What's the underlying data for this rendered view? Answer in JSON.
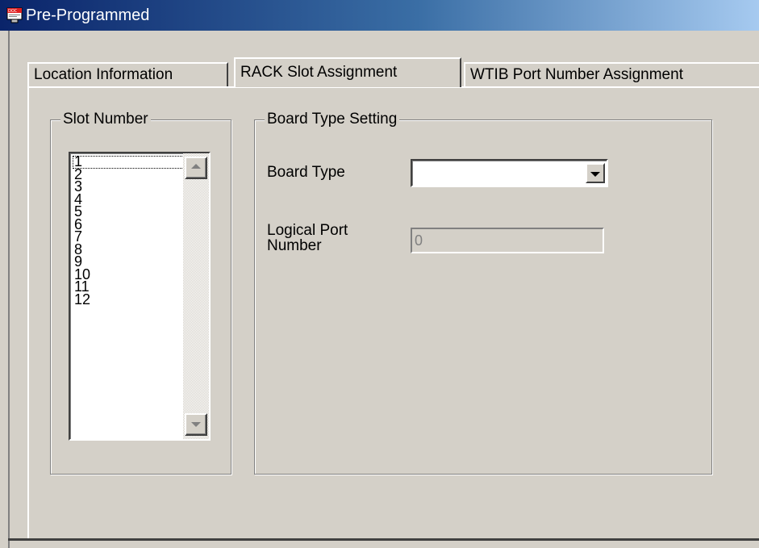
{
  "window": {
    "title": "Pre-Programmed",
    "icon": "doc-app-icon"
  },
  "tabs": [
    {
      "label": "Location Information"
    },
    {
      "label": "RACK Slot Assignment",
      "selected": true
    },
    {
      "label": "WTIB Port Number Assignment"
    }
  ],
  "slot_group": {
    "title": "Slot Number",
    "items": [
      "1",
      "2",
      "3",
      "4",
      "5",
      "6",
      "7",
      "8",
      "9",
      "10",
      "11",
      "12"
    ],
    "selected": "1"
  },
  "board_group": {
    "title": "Board Type Setting",
    "board_type_label": "Board Type",
    "board_type_value": "",
    "logical_port_label": "Logical Port Number",
    "logical_port_value": "0"
  }
}
